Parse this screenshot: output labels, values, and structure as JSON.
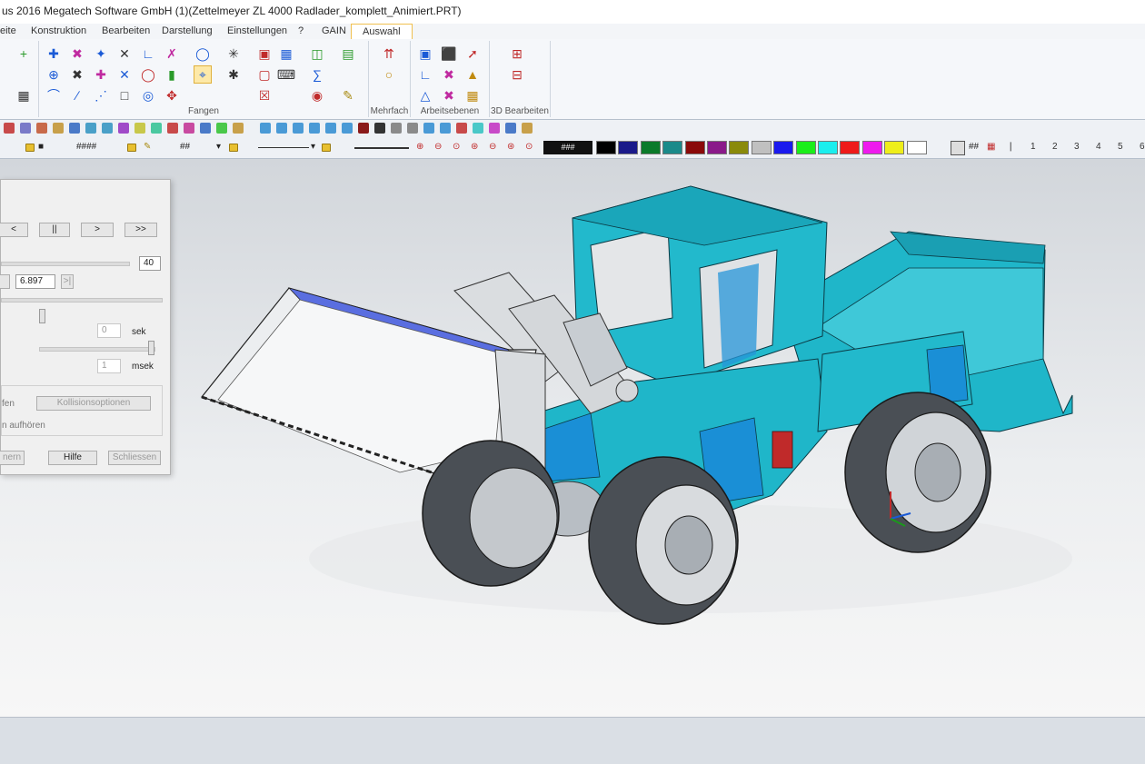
{
  "window": {
    "title": "us 2016  Megatech Software GmbH (1)(Zettelmeyer ZL 4000 Radlader_komplett_Animiert.PRT)"
  },
  "tabs": [
    {
      "label": "eite"
    },
    {
      "label": "Konstruktion"
    },
    {
      "label": "Bearbeiten"
    },
    {
      "label": "Darstellung"
    },
    {
      "label": "Einstellungen"
    },
    {
      "label": "?"
    },
    {
      "label": "GAIN"
    },
    {
      "label": "Auswahl",
      "active": true
    }
  ],
  "ribbon": {
    "groups": [
      {
        "label": "Fangen"
      },
      {
        "label": "Mehrfach"
      },
      {
        "label": "Arbeitsebenen"
      },
      {
        "label": "3D Bearbeiten"
      }
    ]
  },
  "toolbar2": {
    "field1": "####",
    "field2": "##",
    "colorbox": "###",
    "hash_label": "##",
    "palette": [
      "#000000",
      "#1a1a8a",
      "#0a7a2a",
      "#1a8a8a",
      "#8a0a0a",
      "#8a1a8a",
      "#8a8a0a",
      "#c0c0c0",
      "#1a1aee",
      "#1aee1a",
      "#1aeeee",
      "#ee1a1a",
      "#ee1aee",
      "#eeee1a",
      "#ffffff"
    ],
    "layer_numbers": [
      "1",
      "2",
      "3",
      "4",
      "5",
      "6"
    ]
  },
  "dialog": {
    "buttons": {
      "prev": "<",
      "pause": "||",
      "next": ">",
      "fast_forward": ">>"
    },
    "frames_value": "40",
    "time_value": "6.897",
    "seconds": {
      "value": "0",
      "unit": "sek"
    },
    "milliseconds": {
      "value": "1",
      "unit": "msek"
    },
    "collision_partial": "fen",
    "collision_options": "Kollisionsoptionen",
    "stop_partial": "n aufhören",
    "footer": {
      "partial": "nern",
      "help": "Hilfe",
      "close": "Schliessen"
    }
  },
  "colors": {
    "model_cyan": "#1fb6c9",
    "model_blue": "#1a8fd6",
    "accent_tab": "#f0c050"
  }
}
